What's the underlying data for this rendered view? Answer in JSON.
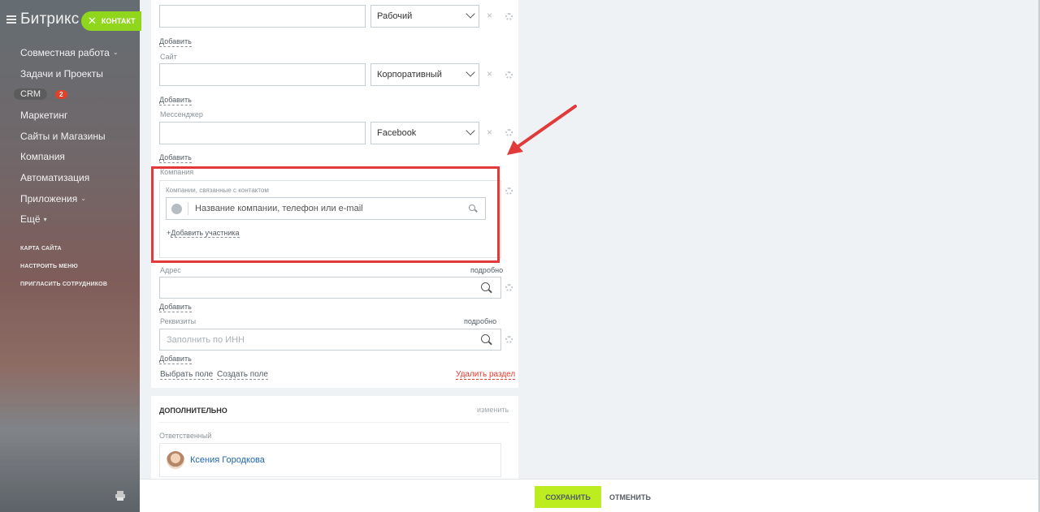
{
  "sidebar": {
    "logo": "Битрикс",
    "contact_chip": "КОНТАКТ",
    "items": [
      {
        "label": "Совместная работа",
        "chevron": true
      },
      {
        "label": "Задачи и Проекты"
      },
      {
        "label": "CRM",
        "badge": "2"
      },
      {
        "label": "Маркетинг"
      },
      {
        "label": "Сайты и Магазины"
      },
      {
        "label": "Компания"
      },
      {
        "label": "Автоматизация"
      },
      {
        "label": "Приложения",
        "chevron": true
      },
      {
        "label": "Ещё"
      }
    ],
    "links": [
      "КАРТА САЙТА",
      "НАСТРОИТЬ МЕНЮ",
      "ПРИГЛАСИТЬ СОТРУДНИКОВ"
    ]
  },
  "form": {
    "phone_type": "Рабочий",
    "add1": "Добавить",
    "site_label": "Сайт",
    "site_type": "Корпоративный",
    "add2": "Добавить",
    "messenger_label": "Мессенджер",
    "messenger_type": "Facebook",
    "add3": "Добавить",
    "company_label": "Компания",
    "company_sub": "Компании, связанные с контактом",
    "company_placeholder": "Название компании, телефон или e-mail",
    "add_participant": "Добавить участника",
    "address_label": "Адрес",
    "address_more": "подробно",
    "add4": "Добавить",
    "requisites_label": "Реквизиты",
    "requisites_more": "подробно",
    "requisites_placeholder": "Заполнить по ИНН",
    "add5": "Добавить",
    "choose_field": "Выбрать поле",
    "create_field": "Создать поле",
    "delete_section": "Удалить раздел"
  },
  "additional": {
    "title": "ДОПОЛНИТЕЛЬНО",
    "edit": "изменить",
    "responsible_label": "Ответственный",
    "responsible_name": "Ксения Городкова"
  },
  "footer": {
    "save": "СОХРАНИТЬ",
    "cancel": "ОТМЕНИТЬ"
  },
  "colors": {
    "accent_green": "#bbed21",
    "highlight_red": "#e23a3a"
  }
}
